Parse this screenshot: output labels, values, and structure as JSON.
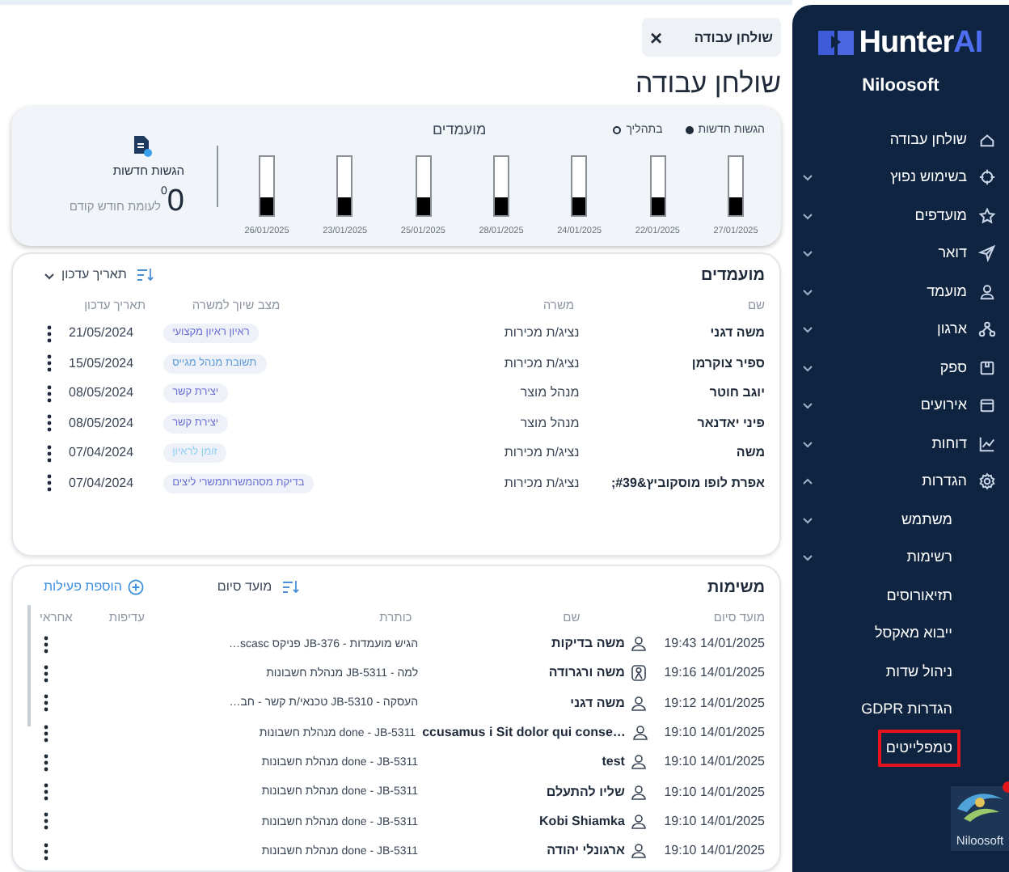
{
  "tab": {
    "label": "שולחן עבודה",
    "close": "×"
  },
  "page_title": "שולחן עבודה",
  "stats": {
    "legend": [
      {
        "label": "הגשות חדשות",
        "kind": "filled"
      },
      {
        "label": "בתהליך",
        "kind": "hollow"
      }
    ],
    "title": "מועמדים",
    "bars": [
      {
        "date": "27/01/2025",
        "level": 0.3
      },
      {
        "date": "22/01/2025",
        "level": 0.3
      },
      {
        "date": "24/01/2025",
        "level": 0.3
      },
      {
        "date": "28/01/2025",
        "level": 0.3
      },
      {
        "date": "25/01/2025",
        "level": 0.3
      },
      {
        "date": "23/01/2025",
        "level": 0.3
      },
      {
        "date": "26/01/2025",
        "level": 0.3
      }
    ],
    "summary": {
      "label": "הגשות חדשות",
      "value": "0",
      "change": "0",
      "compare": "לעומת חודש קודם"
    }
  },
  "candidates": {
    "title": "מועמדים",
    "sort": "תאריך עדכון",
    "columns": [
      "שם",
      "משרה",
      "מצב שיוך למשרה",
      "תאריך עדכון"
    ],
    "rows": [
      {
        "name": "משה דגני",
        "job": "נציג/ת מכירות",
        "status": "ראיון ראיון מקצועי",
        "color": "#6a6fd4",
        "date": "21/05/2024"
      },
      {
        "name": "ספיר צוקרמן",
        "job": "נציג/ת מכירות",
        "status": "תשובת מנהל מגייס",
        "color": "#5a9ad8",
        "date": "15/05/2024"
      },
      {
        "name": "יוגב חוטר",
        "job": "מנהל מוצר",
        "status": "יצירת קשר",
        "color": "#6a6fd4",
        "date": "08/05/2024"
      },
      {
        "name": "פיני יאדנאר",
        "job": "מנהל מוצר",
        "status": "יצירת קשר",
        "color": "#6a6fd4",
        "date": "08/05/2024"
      },
      {
        "name": "משה",
        "job": "נציג/ת מכירות",
        "status": "זומן לראיון",
        "color": "#8ecff0",
        "date": "07/04/2024"
      },
      {
        "name": "אפרת לופו מוסקוביץ&#39;",
        "job": "נציג/ת מכירות",
        "status": "בדיקת מסהמשרותמשרי ליצים",
        "color": "#6a6fd4",
        "date": "07/04/2024"
      }
    ]
  },
  "tasks": {
    "title": "משימות",
    "sort": "מועד סיום",
    "add": "הוספת פעילות",
    "columns": [
      "מועד סיום",
      "שם",
      "כותרת",
      "עדיפות",
      "אחראי"
    ],
    "rows": [
      {
        "due": "19:43 14/01/2025",
        "kind": "person",
        "name": "משה בדיקות",
        "title": "הגיש מועמדות - JB-376 פניקס scasc…"
      },
      {
        "due": "19:16 14/01/2025",
        "kind": "contact",
        "name": "משה ורגרודה",
        "title": "למה - JB-5311 מנהלת חשבונות"
      },
      {
        "due": "19:12 14/01/2025",
        "kind": "person",
        "name": "משה דגני",
        "title": "העסקה - JB-5310 טכנאי/ת קשר - חב…"
      },
      {
        "due": "19:10 14/01/2025",
        "kind": "person",
        "name": "…ccusamus i Sit dolor qui conse",
        "title": "done - JB-5311 מנהלת חשבונות"
      },
      {
        "due": "19:10 14/01/2025",
        "kind": "person",
        "name": "test",
        "title": "done - JB-5311 מנהלת חשבונות"
      },
      {
        "due": "19:10 14/01/2025",
        "kind": "person",
        "name": "שליו להתעלם",
        "title": "done - JB-5311 מנהלת חשבונות"
      },
      {
        "due": "19:10 14/01/2025",
        "kind": "person",
        "name": "Kobi Shiamka",
        "title": "done - JB-5311 מנהלת חשבונות"
      },
      {
        "due": "19:10 14/01/2025",
        "kind": "person",
        "name": "ארגונלי יהודה",
        "title": "done - JB-5311 מנהלת חשבונות"
      }
    ]
  },
  "sidebar": {
    "logo": {
      "text": "Hunter",
      "accent": "AI"
    },
    "company": "Niloosoft",
    "items": [
      {
        "label": "שולחן עבודה"
      },
      {
        "label": "בשימוש נפוץ",
        "expanded": false
      },
      {
        "label": "מועדפים",
        "expanded": false
      },
      {
        "label": "דואר",
        "expanded": false
      },
      {
        "label": "מועמד",
        "expanded": false
      },
      {
        "label": "ארגון",
        "expanded": false
      },
      {
        "label": "ספק",
        "expanded": false
      },
      {
        "label": "אירועים",
        "expanded": false
      },
      {
        "label": "דוחות",
        "expanded": false
      },
      {
        "label": "הגדרות",
        "expanded": true,
        "children": [
          {
            "label": "משתמש",
            "expanded": false,
            "highlighted": false
          },
          {
            "label": "רשימות",
            "expanded": false,
            "highlighted": false
          },
          {
            "label": "תזיאורוסים",
            "highlighted": false
          },
          {
            "label": "ייבוא מאקסל",
            "highlighted": false
          },
          {
            "label": "ניהול שדות",
            "highlighted": false
          },
          {
            "label": "הגדרות GDPR",
            "highlighted": false
          },
          {
            "label": "טמפלייטים",
            "highlighted": true
          }
        ]
      }
    ],
    "bottom_logo": {
      "text": "Niloosoft",
      "notification": true
    }
  }
}
